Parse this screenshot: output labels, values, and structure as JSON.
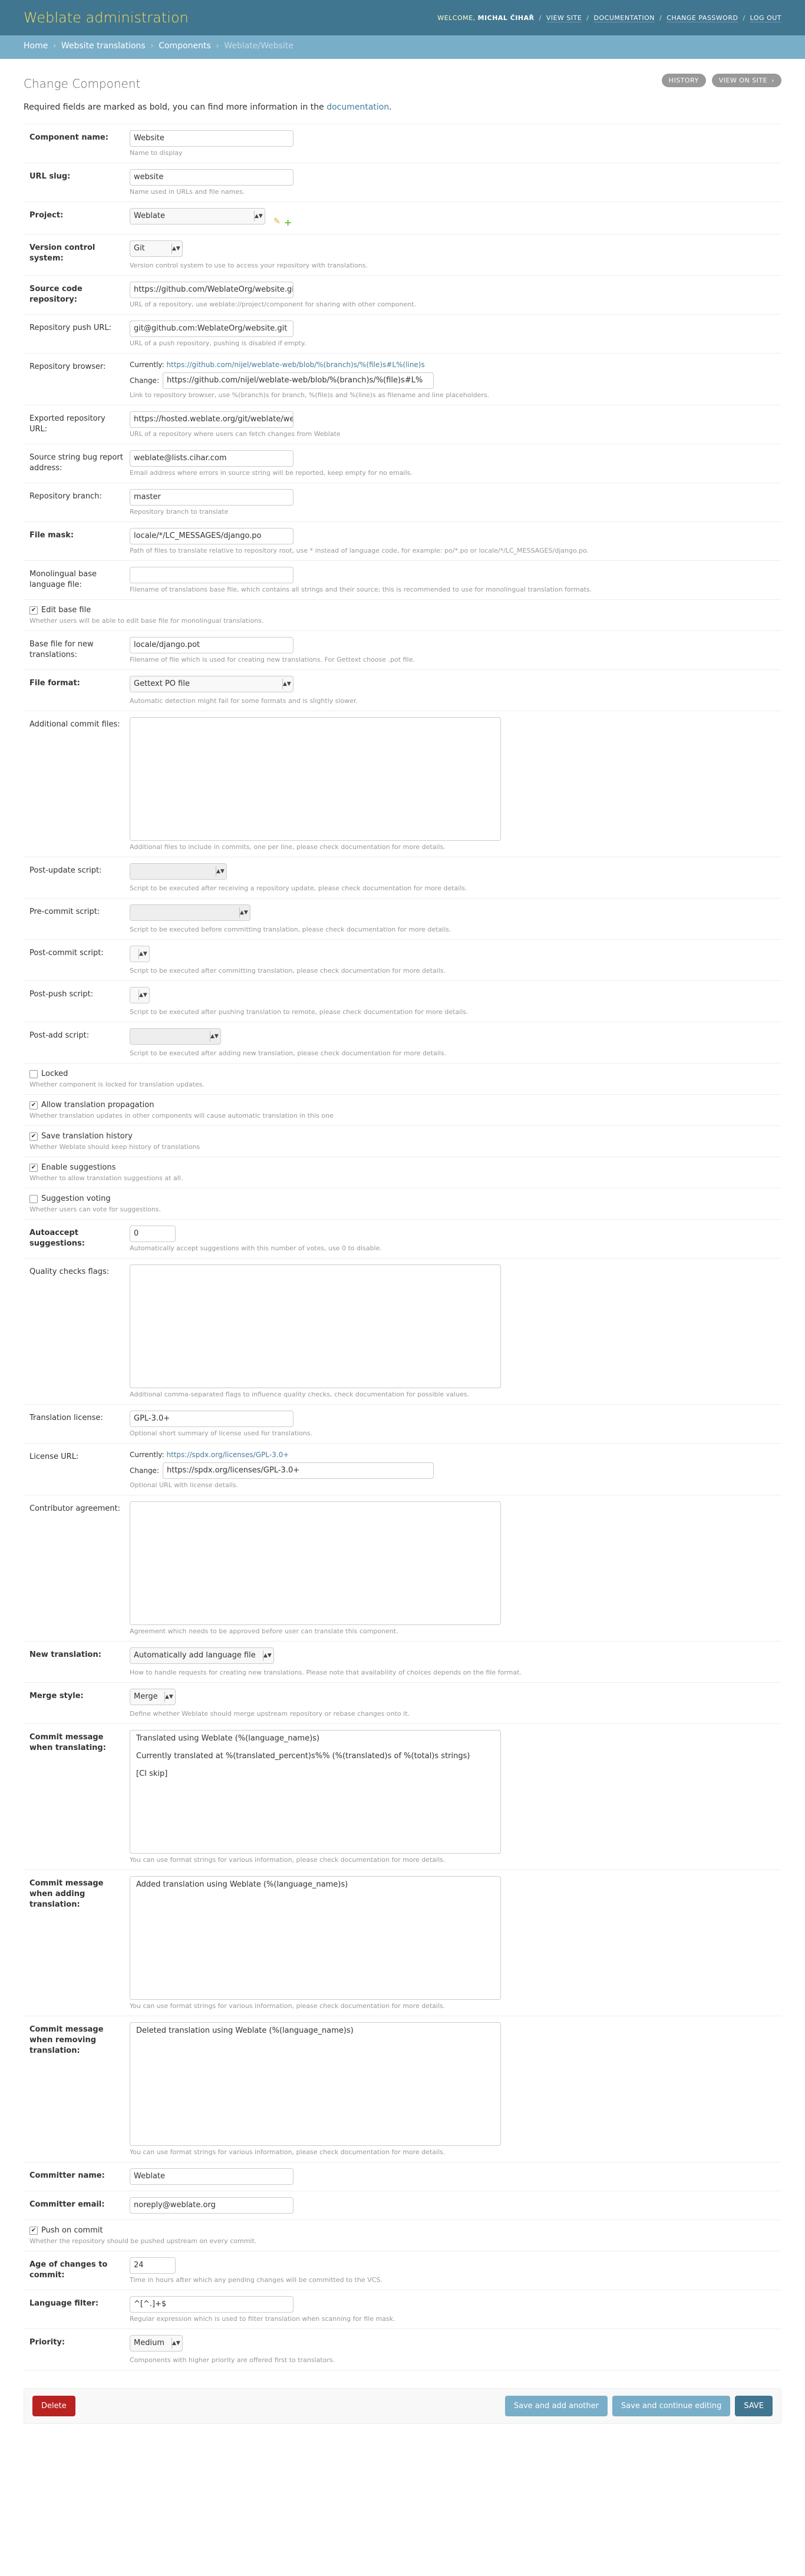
{
  "header": {
    "branding": "Weblate administration",
    "welcome": "Welcome,",
    "user": "Michal Čihař",
    "links": [
      "View site",
      "Documentation",
      "Change password",
      "Log out"
    ]
  },
  "breadcrumbs": [
    "Home",
    "Website translations",
    "Components",
    "Weblate/Website"
  ],
  "page": {
    "title": "Change Component",
    "intro_text": "Required fields are marked as bold, you can find more information in the",
    "intro_link": "documentation",
    "intro_end": ".",
    "tools": {
      "history": "History",
      "view_on_site": "View on site",
      "arrow": "›"
    }
  },
  "fields": {
    "name": {
      "label": "Component name:",
      "value": "Website",
      "help": "Name to display"
    },
    "slug": {
      "label": "URL slug:",
      "value": "website",
      "help": "Name used in URLs and file names."
    },
    "project": {
      "label": "Project:",
      "value": "Weblate"
    },
    "vcs": {
      "label": "Version control system:",
      "value": "Git",
      "help": "Version control system to use to access your repository with translations."
    },
    "repo": {
      "label": "Source code repository:",
      "value": "https://github.com/WeblateOrg/website.git",
      "help": "URL of a repository, use weblate://project/component for sharing with other component."
    },
    "push": {
      "label": "Repository push URL:",
      "value": "git@github.com:WeblateOrg/website.git",
      "help": "URL of a push repository, pushing is disabled if empty."
    },
    "browser": {
      "label": "Repository browser:",
      "currently_label": "Currently:",
      "currently_value": "https://github.com/nijel/weblate-web/blob/%(branch)s/%(file)s#L%(line)s",
      "change_label": "Change:",
      "change_value": "https://github.com/nijel/weblate-web/blob/%(branch)s/%(file)s#L%",
      "help": "Link to repository browser, use %(branch)s for branch, %(file)s and %(line)s as filename and line placeholders."
    },
    "exported": {
      "label": "Exported repository URL:",
      "value": "https://hosted.weblate.org/git/weblate/websi",
      "help": "URL of a repository where users can fetch changes from Weblate"
    },
    "bug": {
      "label": "Source string bug report address:",
      "value": "weblate@lists.cihar.com",
      "help": "Email address where errors in source string will be reported, keep empty for no emails."
    },
    "branch": {
      "label": "Repository branch:",
      "value": "master",
      "help": "Repository branch to translate"
    },
    "filemask": {
      "label": "File mask:",
      "value": "locale/*/LC_MESSAGES/django.po",
      "help": "Path of files to translate relative to repository root, use * instead of language code, for example: po/*.po or locale/*/LC_MESSAGES/django.po."
    },
    "monolingual": {
      "label": "Monolingual base language file:",
      "value": "",
      "help": "Filename of translations base file, which contains all strings and their source; this is recommended to use for monolingual translation formats."
    },
    "edit_template": {
      "label": "Edit base file",
      "checked": true,
      "help": "Whether users will be able to edit base file for monolingual translations."
    },
    "new_base": {
      "label": "Base file for new translations:",
      "value": "locale/django.pot",
      "help": "Filename of file which is used for creating new translations. For Gettext choose .pot file."
    },
    "file_format": {
      "label": "File format:",
      "value": "Gettext PO file",
      "help": "Automatic detection might fail for some formats and is slightly slower."
    },
    "extra_commit": {
      "label": "Additional commit files:",
      "value": "",
      "help": "Additional files to include in commits, one per line, please check documentation for more details."
    },
    "post_update": {
      "label": "Post-update script:",
      "value": "",
      "help": "Script to be executed after receiving a repository update, please check documentation for more details."
    },
    "pre_commit": {
      "label": "Pre-commit script:",
      "value": "",
      "help": "Script to be executed before committing translation, please check documentation for more details."
    },
    "post_commit": {
      "label": "Post-commit script:",
      "value": "",
      "help": "Script to be executed after committing translation, please check documentation for more details."
    },
    "post_push": {
      "label": "Post-push script:",
      "value": "",
      "help": "Script to be executed after pushing translation to remote, please check documentation for more details."
    },
    "post_add": {
      "label": "Post-add script:",
      "value": "",
      "help": "Script to be executed after adding new translation, please check documentation for more details."
    },
    "locked": {
      "label": "Locked",
      "checked": false,
      "help": "Whether component is locked for translation updates."
    },
    "propagation": {
      "label": "Allow translation propagation",
      "checked": true,
      "help": "Whether translation updates in other components will cause automatic translation in this one"
    },
    "history": {
      "label": "Save translation history",
      "checked": true,
      "help": "Whether Weblate should keep history of translations"
    },
    "suggestions": {
      "label": "Enable suggestions",
      "checked": true,
      "help": "Whether to allow translation suggestions at all."
    },
    "voting": {
      "label": "Suggestion voting",
      "checked": false,
      "help": "Whether users can vote for suggestions."
    },
    "autoaccept": {
      "label": "Autoaccept suggestions:",
      "value": "0",
      "help": "Automatically accept suggestions with this number of votes, use 0 to disable."
    },
    "check_flags": {
      "label": "Quality checks flags:",
      "value": "",
      "help": "Additional comma-separated flags to influence quality checks, check documentation for possible values."
    },
    "license": {
      "label": "Translation license:",
      "value": "GPL-3.0+",
      "help": "Optional short summary of license used for translations."
    },
    "license_url": {
      "label": "License URL:",
      "currently_label": "Currently:",
      "currently_value": "https://spdx.org/licenses/GPL-3.0+",
      "change_label": "Change:",
      "change_value": "https://spdx.org/licenses/GPL-3.0+",
      "help": "Optional URL with license details."
    },
    "agreement": {
      "label": "Contributor agreement:",
      "value": "",
      "help": "Agreement which needs to be approved before user can translate this component."
    },
    "new_lang": {
      "label": "New translation:",
      "value": "Automatically add language file",
      "help": "How to handle requests for creating new translations. Please note that availability of choices depends on the file format."
    },
    "merge": {
      "label": "Merge style:",
      "value": "Merge",
      "help": "Define whether Weblate should merge upstream repository or rebase changes onto it."
    },
    "commit_msg": {
      "label": "Commit message when translating:",
      "value": "Translated using Weblate (%(language_name)s)\n\nCurrently translated at %(translated_percent)s%% (%(translated)s of %(total)s strings)\n\n[CI skip]",
      "help": "You can use format strings for various information, please check documentation for more details."
    },
    "add_msg": {
      "label": "Commit message when adding translation:",
      "value": "Added translation using Weblate (%(language_name)s)",
      "help": "You can use format strings for various information, please check documentation for more details."
    },
    "delete_msg": {
      "label": "Commit message when removing translation:",
      "value": "Deleted translation using Weblate (%(language_name)s)",
      "help": "You can use format strings for various information, please check documentation for more details."
    },
    "committer_name": {
      "label": "Committer name:",
      "value": "Weblate"
    },
    "committer_email": {
      "label": "Committer email:",
      "value": "noreply@weblate.org"
    },
    "push_commit": {
      "label": "Push on commit",
      "checked": true,
      "help": "Whether the repository should be pushed upstream on every commit."
    },
    "commit_age": {
      "label": "Age of changes to commit:",
      "value": "24",
      "help": "Time in hours after which any pending changes will be committed to the VCS."
    },
    "lang_filter": {
      "label": "Language filter:",
      "value": "^[^.]+$",
      "help": "Regular expression which is used to filter translation when scanning for file mask."
    },
    "priority": {
      "label": "Priority:",
      "value": "Medium",
      "help": "Components with higher priority are offered first to translators."
    }
  },
  "submit": {
    "delete": "Delete",
    "save_add": "Save and add another",
    "save_continue": "Save and continue editing",
    "save": "SAVE"
  }
}
